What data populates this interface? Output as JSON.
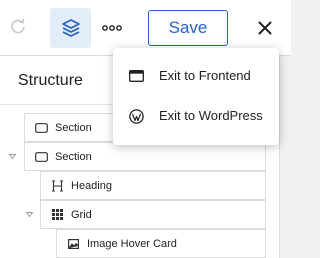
{
  "toolbar": {
    "save_label": "Save",
    "icons": [
      "redo-icon",
      "layers-icon",
      "more-options-icon",
      "close-icon"
    ],
    "accent_color": "#2563c8"
  },
  "structure": {
    "title": "Structure",
    "nodes": [
      {
        "label": "Section",
        "icon": "section-icon",
        "expanded": false
      },
      {
        "label": "Section",
        "icon": "section-icon",
        "expanded": true
      },
      {
        "label": "Heading",
        "icon": "heading-icon"
      },
      {
        "label": "Grid",
        "icon": "grid-icon",
        "expanded": true
      },
      {
        "label": "Image Hover Card",
        "icon": "image-icon"
      }
    ]
  },
  "menu": {
    "items": [
      {
        "label": "Exit to Frontend",
        "icon": "browser-window-icon"
      },
      {
        "label": "Exit to WordPress",
        "icon": "wordpress-icon"
      }
    ]
  }
}
